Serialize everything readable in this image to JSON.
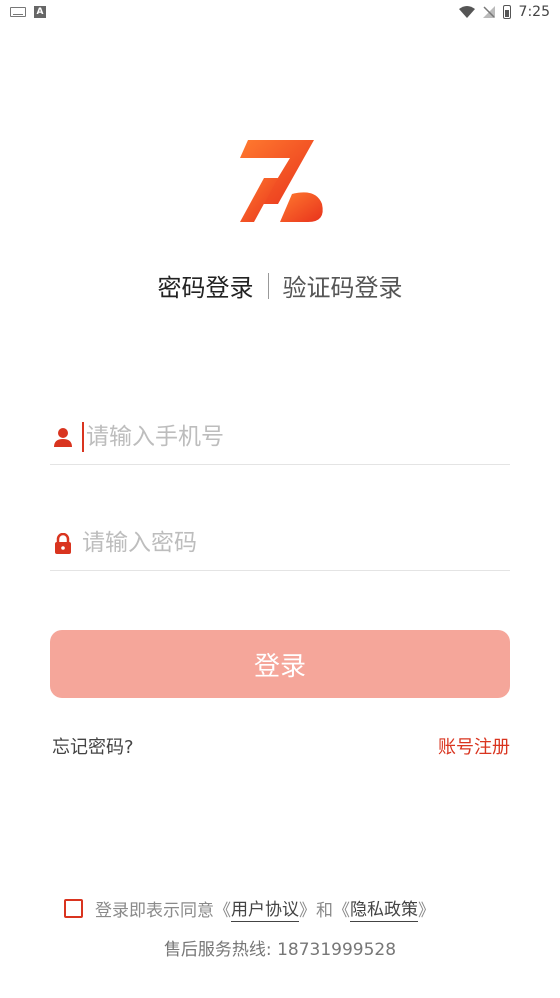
{
  "status_bar": {
    "time": "7:25"
  },
  "colors": {
    "accent": "#d9341f",
    "button_bg": "#f5a69a",
    "logo_start": "#ff7a2f",
    "logo_end": "#e8321c"
  },
  "tabs": {
    "password_login": "密码登录",
    "code_login": "验证码登录"
  },
  "phone_field": {
    "placeholder": "请输入手机号",
    "value": ""
  },
  "password_field": {
    "placeholder": "请输入密码",
    "value": ""
  },
  "login_button": "登录",
  "forgot_password": "忘记密码?",
  "register": "账号注册",
  "agreement": {
    "prefix": "登录即表示同意",
    "user_agreement": "用户协议",
    "and": "和",
    "privacy_policy": "隐私政策",
    "checked": false
  },
  "hotline": "售后服务热线: 18731999528",
  "icons": {
    "user": "user-icon",
    "lock": "lock-icon",
    "wifi": "wifi-icon",
    "battery": "battery-icon"
  }
}
